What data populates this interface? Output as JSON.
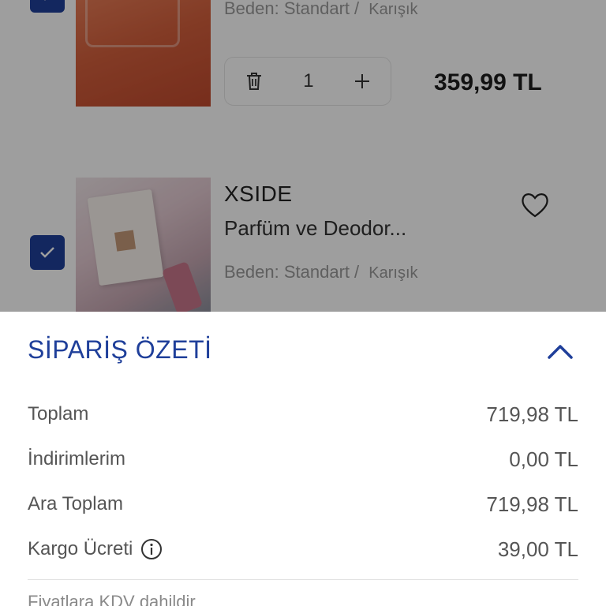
{
  "cart": {
    "items": [
      {
        "variant_label": "Beden:",
        "variant_value": "Standart",
        "color": "Karışık",
        "quantity": "1",
        "price": "359,99 TL"
      },
      {
        "brand": "XSIDE",
        "name": "Parfüm ve Deodor...",
        "variant_label": "Beden:",
        "variant_value": "Standart",
        "color": "Karışık"
      }
    ]
  },
  "summary": {
    "title": "SİPARİŞ ÖZETİ",
    "rows": [
      {
        "label": "Toplam",
        "value": "719,98 TL"
      },
      {
        "label": "İndirimlerim",
        "value": "0,00 TL"
      },
      {
        "label": "Ara Toplam",
        "value": "719,98 TL"
      },
      {
        "label": "Kargo Ücreti",
        "value": "39,00 TL"
      }
    ],
    "note": "Fiyatlara KDV dahildir"
  },
  "colors": {
    "accent": "#1f3f9a",
    "overlay": "rgba(0,0,0,0.38)"
  }
}
